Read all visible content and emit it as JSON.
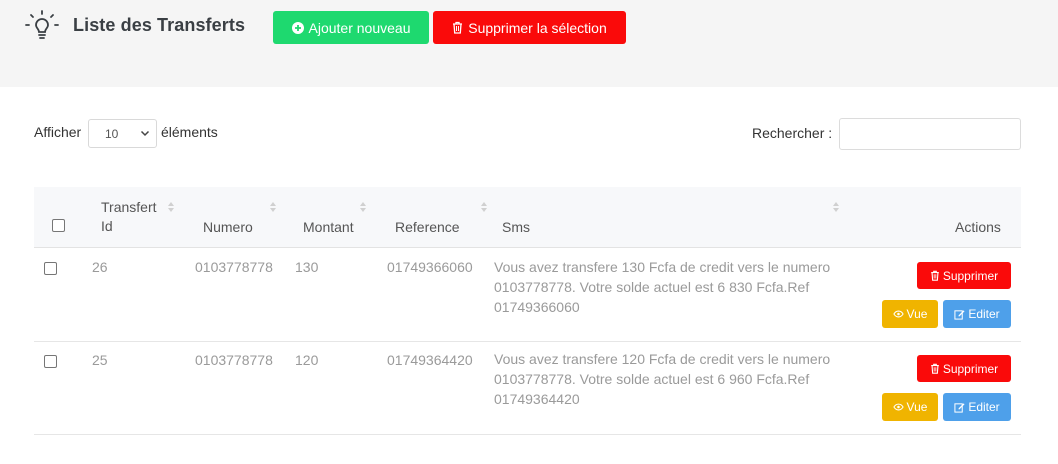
{
  "header": {
    "title": "Liste des Transferts",
    "add_label": "Ajouter nouveau",
    "delete_selected_label": "Supprimer la sélection"
  },
  "controls": {
    "show_prefix": "Afficher",
    "page_size": "10",
    "show_suffix": "éléments",
    "search_label": "Rechercher :",
    "search_value": ""
  },
  "table": {
    "columns": {
      "id_line1": "Transfert",
      "id_line2": "Id",
      "numero": "Numero",
      "montant": "Montant",
      "reference": "Reference",
      "sms": "Sms",
      "actions": "Actions"
    },
    "rows": [
      {
        "id": "26",
        "numero": "0103778778",
        "montant": "130",
        "reference": "01749366060",
        "sms_lines": [
          "Vous avez transfere 130 Fcfa de credit vers le numero",
          "0103778778. Votre solde actuel est 6 830 Fcfa.Ref",
          "01749366060"
        ]
      },
      {
        "id": "25",
        "numero": "0103778778",
        "montant": "120",
        "reference": "01749364420",
        "sms_lines": [
          "Vous avez transfere 120 Fcfa de credit vers le numero",
          "0103778778. Votre solde actuel est 6 960 Fcfa.Ref",
          "01749364420"
        ]
      }
    ],
    "row_actions": {
      "delete_label": "Supprimer",
      "view_label": "Vue",
      "edit_label": "Editer"
    }
  },
  "colors": {
    "add": "#1ed96f",
    "danger": "#fa0a0a",
    "warning": "#f0b400",
    "info": "#4ea0ea"
  },
  "icons": {
    "page": "lightbulb-icon",
    "add": "plus-circle-icon",
    "delete": "trash-icon",
    "view": "eye-icon",
    "edit": "edit-icon"
  }
}
